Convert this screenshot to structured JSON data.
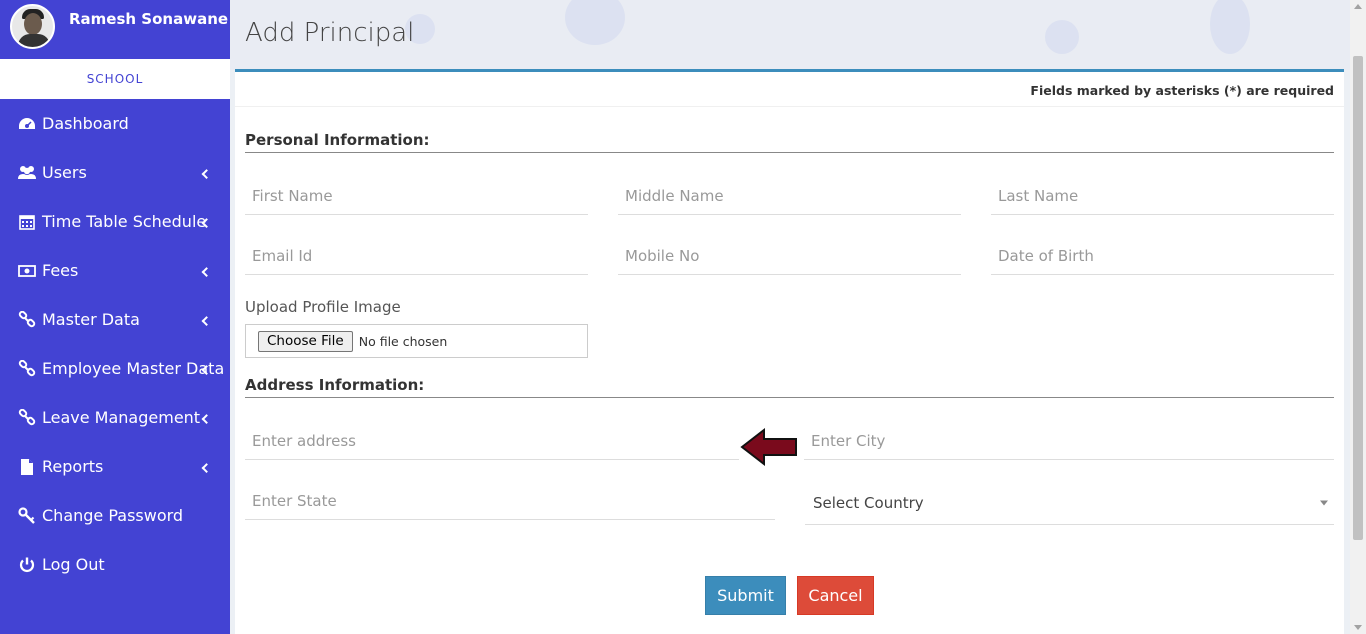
{
  "user": {
    "name": "Ramesh Sonawane",
    "role": "SCHOOL"
  },
  "sidebar": {
    "items": [
      {
        "label": "Dashboard",
        "icon": "dashboard-icon",
        "has_submenu": false
      },
      {
        "label": "Users",
        "icon": "users-icon",
        "has_submenu": true
      },
      {
        "label": "Time Table Schedule",
        "icon": "calendar-icon",
        "has_submenu": true
      },
      {
        "label": "Fees",
        "icon": "money-icon",
        "has_submenu": true
      },
      {
        "label": "Master Data",
        "icon": "link-icon",
        "has_submenu": true
      },
      {
        "label": "Employee Master Data",
        "icon": "link-icon",
        "has_submenu": true
      },
      {
        "label": "Leave Management",
        "icon": "link-icon",
        "has_submenu": true
      },
      {
        "label": "Reports",
        "icon": "file-icon",
        "has_submenu": true
      },
      {
        "label": "Change Password",
        "icon": "key-icon",
        "has_submenu": false
      },
      {
        "label": "Log Out",
        "icon": "power-icon",
        "has_submenu": false
      }
    ]
  },
  "page": {
    "title": "Add Principal",
    "required_note": "Fields marked by asterisks (*) are required"
  },
  "personal": {
    "title": "Personal Information:",
    "first_name": "First Name",
    "middle_name": "Middle Name",
    "last_name": "Last Name",
    "email": "Email Id",
    "mobile": "Mobile No",
    "dob": "Date of Birth",
    "upload_label": "Upload Profile Image",
    "file_button": "Choose File",
    "file_status": "No file chosen"
  },
  "address": {
    "title": "Address Information:",
    "address": "Enter address",
    "city": "Enter City",
    "state": "Enter State",
    "country": "Select Country"
  },
  "actions": {
    "submit": "Submit",
    "cancel": "Cancel"
  },
  "colors": {
    "sidebar": "#4343d3",
    "box_accent": "#3c8dbc",
    "submit": "#3c8dbc",
    "cancel": "#dd4b39",
    "arrow": "#7a0a1c"
  }
}
